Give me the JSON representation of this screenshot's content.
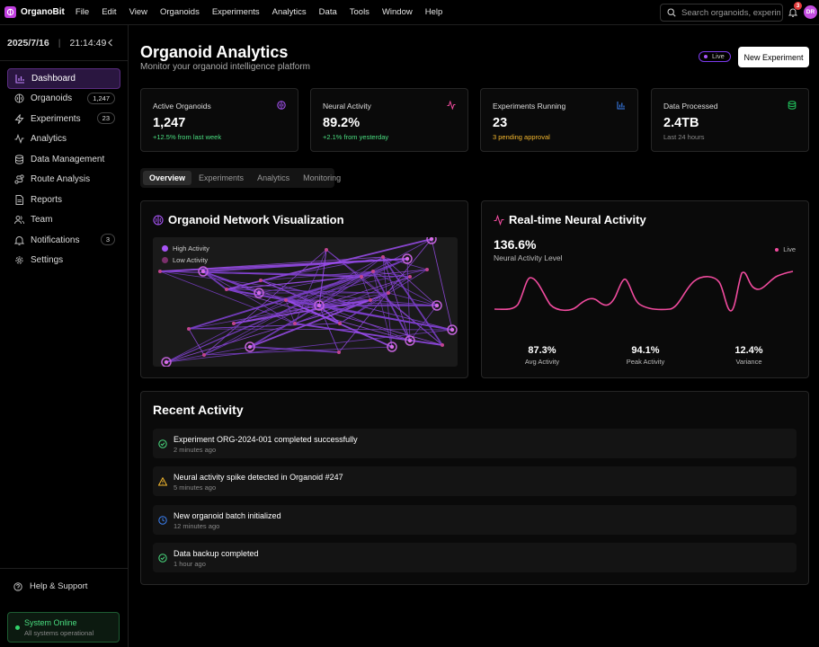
{
  "app": {
    "name": "OrganoBit"
  },
  "menu": [
    "File",
    "Edit",
    "View",
    "Organoids",
    "Experiments",
    "Analytics",
    "Data",
    "Tools",
    "Window",
    "Help"
  ],
  "search": {
    "placeholder": "Search organoids, experiments..."
  },
  "notifications": {
    "count": "3"
  },
  "user": {
    "initials": "DR"
  },
  "clock": {
    "date": "2025/7/16",
    "time": "21:14:49"
  },
  "sidebar": {
    "items": [
      {
        "label": "Dashboard",
        "icon": "chart-bar-icon",
        "badge": ""
      },
      {
        "label": "Organoids",
        "icon": "brain-icon",
        "badge": "1,247"
      },
      {
        "label": "Experiments",
        "icon": "zap-icon",
        "badge": "23"
      },
      {
        "label": "Analytics",
        "icon": "activity-icon",
        "badge": ""
      },
      {
        "label": "Data Management",
        "icon": "database-icon",
        "badge": ""
      },
      {
        "label": "Route Analysis",
        "icon": "route-icon",
        "badge": ""
      },
      {
        "label": "Reports",
        "icon": "file-text-icon",
        "badge": ""
      },
      {
        "label": "Team",
        "icon": "users-icon",
        "badge": ""
      },
      {
        "label": "Notifications",
        "icon": "bell-icon",
        "badge": "3"
      },
      {
        "label": "Settings",
        "icon": "gear-icon",
        "badge": ""
      }
    ],
    "help": "Help & Support",
    "status": {
      "title": "System Online",
      "subtitle": "All systems operational"
    }
  },
  "header": {
    "title": "Organoid Analytics",
    "subtitle": "Monitor your organoid intelligence platform",
    "live": "Live",
    "new_button": "New Experiment"
  },
  "stats": [
    {
      "label": "Active Organoids",
      "value": "1,247",
      "sub": "+12.5% from last week",
      "sub_color": "#4ade80",
      "icon": "brain-icon"
    },
    {
      "label": "Neural Activity",
      "value": "89.2%",
      "sub": "+2.1% from yesterday",
      "sub_color": "#4ade80",
      "icon": "activity-icon"
    },
    {
      "label": "Experiments Running",
      "value": "23",
      "sub": "3 pending approval",
      "sub_color": "#f5b82e",
      "icon": "chart-bar-icon"
    },
    {
      "label": "Data Processed",
      "value": "2.4TB",
      "sub": "Last 24 hours",
      "sub_color": "#888888",
      "icon": "database-icon"
    }
  ],
  "tabs": [
    "Overview",
    "Experiments",
    "Analytics",
    "Monitoring"
  ],
  "network": {
    "title": "Organoid Network Visualization",
    "legend": [
      {
        "label": "High Activity",
        "color": "#a855f7"
      },
      {
        "label": "Low Activity",
        "color": "#7a2f6b"
      }
    ]
  },
  "neural": {
    "title": "Real-time Neural Activity",
    "value": "136.6%",
    "label": "Neural Activity Level",
    "live": "Live",
    "metrics": [
      {
        "value": "87.3%",
        "label": "Avg Activity"
      },
      {
        "value": "94.1%",
        "label": "Peak Activity"
      },
      {
        "value": "12.4%",
        "label": "Variance"
      }
    ]
  },
  "activity": {
    "title": "Recent Activity",
    "items": [
      {
        "text": "Experiment ORG-2024-001 completed successfully",
        "time": "2 minutes ago",
        "icon": "check-circle-icon",
        "color": "#4ade80"
      },
      {
        "text": "Neural activity spike detected in Organoid #247",
        "time": "5 minutes ago",
        "icon": "warning-icon",
        "color": "#f5b82e"
      },
      {
        "text": "New organoid batch initialized",
        "time": "12 minutes ago",
        "icon": "clock-icon",
        "color": "#3b82f6"
      },
      {
        "text": "Data backup completed",
        "time": "1 hour ago",
        "icon": "check-circle-icon",
        "color": "#4ade80"
      }
    ]
  }
}
